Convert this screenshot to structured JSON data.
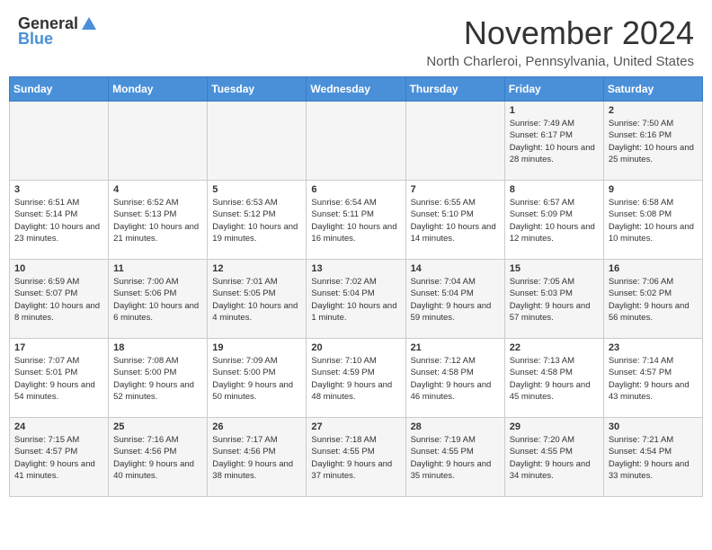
{
  "header": {
    "logo_general": "General",
    "logo_blue": "Blue",
    "month_title": "November 2024",
    "location": "North Charleroi, Pennsylvania, United States"
  },
  "calendar": {
    "days_of_week": [
      "Sunday",
      "Monday",
      "Tuesday",
      "Wednesday",
      "Thursday",
      "Friday",
      "Saturday"
    ],
    "weeks": [
      [
        {
          "day": "",
          "info": ""
        },
        {
          "day": "",
          "info": ""
        },
        {
          "day": "",
          "info": ""
        },
        {
          "day": "",
          "info": ""
        },
        {
          "day": "",
          "info": ""
        },
        {
          "day": "1",
          "info": "Sunrise: 7:49 AM\nSunset: 6:17 PM\nDaylight: 10 hours and 28 minutes."
        },
        {
          "day": "2",
          "info": "Sunrise: 7:50 AM\nSunset: 6:16 PM\nDaylight: 10 hours and 25 minutes."
        }
      ],
      [
        {
          "day": "3",
          "info": "Sunrise: 6:51 AM\nSunset: 5:14 PM\nDaylight: 10 hours and 23 minutes."
        },
        {
          "day": "4",
          "info": "Sunrise: 6:52 AM\nSunset: 5:13 PM\nDaylight: 10 hours and 21 minutes."
        },
        {
          "day": "5",
          "info": "Sunrise: 6:53 AM\nSunset: 5:12 PM\nDaylight: 10 hours and 19 minutes."
        },
        {
          "day": "6",
          "info": "Sunrise: 6:54 AM\nSunset: 5:11 PM\nDaylight: 10 hours and 16 minutes."
        },
        {
          "day": "7",
          "info": "Sunrise: 6:55 AM\nSunset: 5:10 PM\nDaylight: 10 hours and 14 minutes."
        },
        {
          "day": "8",
          "info": "Sunrise: 6:57 AM\nSunset: 5:09 PM\nDaylight: 10 hours and 12 minutes."
        },
        {
          "day": "9",
          "info": "Sunrise: 6:58 AM\nSunset: 5:08 PM\nDaylight: 10 hours and 10 minutes."
        }
      ],
      [
        {
          "day": "10",
          "info": "Sunrise: 6:59 AM\nSunset: 5:07 PM\nDaylight: 10 hours and 8 minutes."
        },
        {
          "day": "11",
          "info": "Sunrise: 7:00 AM\nSunset: 5:06 PM\nDaylight: 10 hours and 6 minutes."
        },
        {
          "day": "12",
          "info": "Sunrise: 7:01 AM\nSunset: 5:05 PM\nDaylight: 10 hours and 4 minutes."
        },
        {
          "day": "13",
          "info": "Sunrise: 7:02 AM\nSunset: 5:04 PM\nDaylight: 10 hours and 1 minute."
        },
        {
          "day": "14",
          "info": "Sunrise: 7:04 AM\nSunset: 5:04 PM\nDaylight: 9 hours and 59 minutes."
        },
        {
          "day": "15",
          "info": "Sunrise: 7:05 AM\nSunset: 5:03 PM\nDaylight: 9 hours and 57 minutes."
        },
        {
          "day": "16",
          "info": "Sunrise: 7:06 AM\nSunset: 5:02 PM\nDaylight: 9 hours and 56 minutes."
        }
      ],
      [
        {
          "day": "17",
          "info": "Sunrise: 7:07 AM\nSunset: 5:01 PM\nDaylight: 9 hours and 54 minutes."
        },
        {
          "day": "18",
          "info": "Sunrise: 7:08 AM\nSunset: 5:00 PM\nDaylight: 9 hours and 52 minutes."
        },
        {
          "day": "19",
          "info": "Sunrise: 7:09 AM\nSunset: 5:00 PM\nDaylight: 9 hours and 50 minutes."
        },
        {
          "day": "20",
          "info": "Sunrise: 7:10 AM\nSunset: 4:59 PM\nDaylight: 9 hours and 48 minutes."
        },
        {
          "day": "21",
          "info": "Sunrise: 7:12 AM\nSunset: 4:58 PM\nDaylight: 9 hours and 46 minutes."
        },
        {
          "day": "22",
          "info": "Sunrise: 7:13 AM\nSunset: 4:58 PM\nDaylight: 9 hours and 45 minutes."
        },
        {
          "day": "23",
          "info": "Sunrise: 7:14 AM\nSunset: 4:57 PM\nDaylight: 9 hours and 43 minutes."
        }
      ],
      [
        {
          "day": "24",
          "info": "Sunrise: 7:15 AM\nSunset: 4:57 PM\nDaylight: 9 hours and 41 minutes."
        },
        {
          "day": "25",
          "info": "Sunrise: 7:16 AM\nSunset: 4:56 PM\nDaylight: 9 hours and 40 minutes."
        },
        {
          "day": "26",
          "info": "Sunrise: 7:17 AM\nSunset: 4:56 PM\nDaylight: 9 hours and 38 minutes."
        },
        {
          "day": "27",
          "info": "Sunrise: 7:18 AM\nSunset: 4:55 PM\nDaylight: 9 hours and 37 minutes."
        },
        {
          "day": "28",
          "info": "Sunrise: 7:19 AM\nSunset: 4:55 PM\nDaylight: 9 hours and 35 minutes."
        },
        {
          "day": "29",
          "info": "Sunrise: 7:20 AM\nSunset: 4:55 PM\nDaylight: 9 hours and 34 minutes."
        },
        {
          "day": "30",
          "info": "Sunrise: 7:21 AM\nSunset: 4:54 PM\nDaylight: 9 hours and 33 minutes."
        }
      ]
    ]
  }
}
